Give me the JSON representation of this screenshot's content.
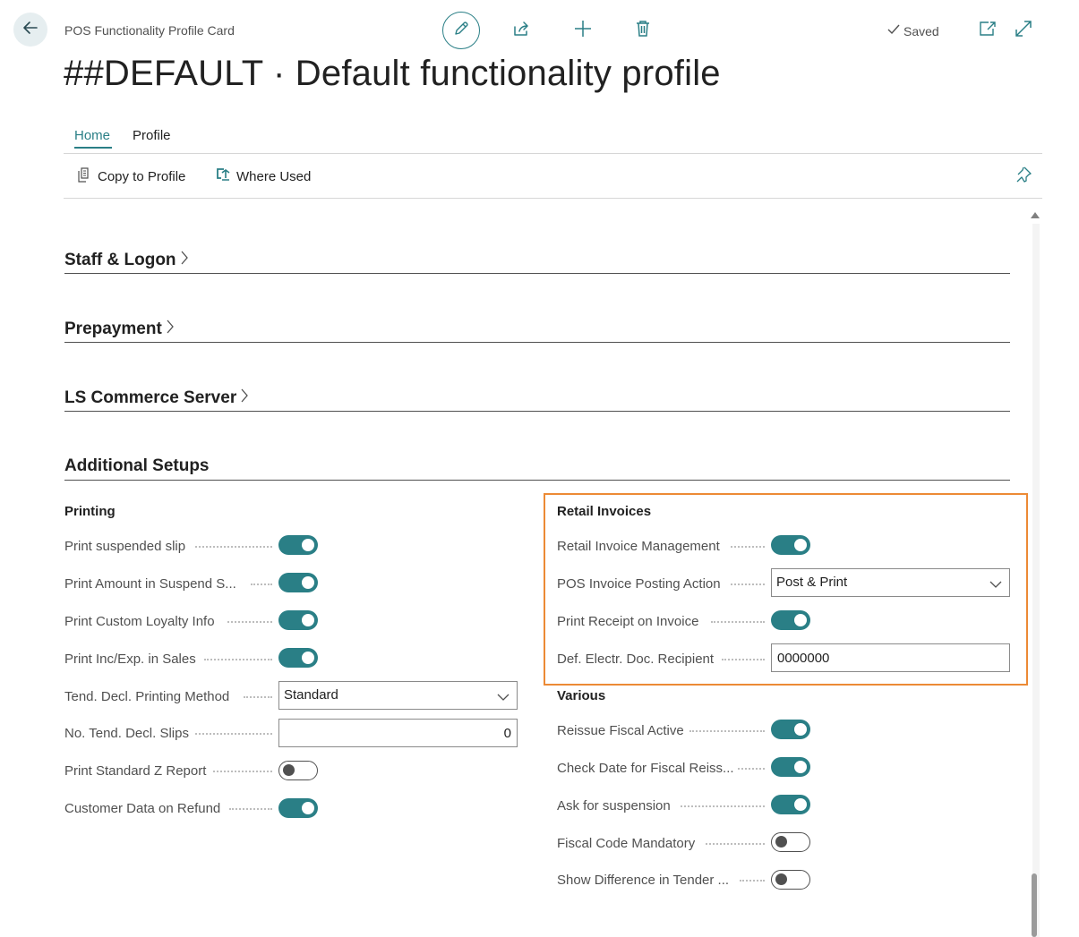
{
  "header": {
    "page_type": "POS Functionality Profile Card",
    "title": "##DEFAULT · Default functionality profile",
    "saved_label": "Saved"
  },
  "tabs": [
    "Home",
    "Profile"
  ],
  "actions": {
    "copy_to_profile": "Copy to Profile",
    "where_used": "Where Used"
  },
  "fasttabs": {
    "staff_logon": "Staff & Logon",
    "prepayment": "Prepayment",
    "ls_commerce_server": "LS Commerce Server",
    "additional_setups": "Additional Setups"
  },
  "printing": {
    "heading": "Printing",
    "print_suspended_slip": {
      "label": "Print suspended slip",
      "value": true
    },
    "print_amount_in_suspend": {
      "label": "Print Amount in Suspend S...",
      "value": true
    },
    "print_custom_loyalty_info": {
      "label": "Print Custom Loyalty Info",
      "value": true
    },
    "print_inc_exp_in_sales": {
      "label": "Print Inc/Exp. in Sales",
      "value": true
    },
    "tend_decl_printing_method": {
      "label": "Tend. Decl. Printing Method",
      "value": "Standard"
    },
    "no_tend_decl_slips": {
      "label": "No. Tend. Decl. Slips",
      "value": "0"
    },
    "print_standard_z_report": {
      "label": "Print Standard Z Report",
      "value": false
    },
    "customer_data_on_refund": {
      "label": "Customer Data on Refund",
      "value": true
    }
  },
  "retail_invoices": {
    "heading": "Retail Invoices",
    "retail_invoice_management": {
      "label": "Retail Invoice Management",
      "value": true
    },
    "pos_invoice_posting_action": {
      "label": "POS Invoice Posting Action",
      "value": "Post & Print"
    },
    "print_receipt_on_invoice": {
      "label": "Print Receipt on Invoice",
      "value": true
    },
    "def_electr_doc_recipient": {
      "label": "Def. Electr. Doc. Recipient",
      "value": "0000000"
    }
  },
  "various": {
    "heading": "Various",
    "reissue_fiscal_active": {
      "label": "Reissue Fiscal Active",
      "value": true
    },
    "check_date_for_fiscal_reissue": {
      "label": "Check Date for Fiscal Reiss...",
      "value": true
    },
    "ask_for_suspension": {
      "label": "Ask for suspension",
      "value": true
    },
    "fiscal_code_mandatory": {
      "label": "Fiscal Code Mandatory",
      "value": false
    },
    "show_difference_in_tender": {
      "label": "Show Difference in Tender ...",
      "value": false
    }
  },
  "colors": {
    "accent": "#2a7f86",
    "highlight_box": "#ec8a35",
    "toggle_off_knob": "#505050"
  },
  "icons": {
    "back": "arrow-left-icon",
    "edit": "pencil-icon",
    "share": "share-icon",
    "new": "plus-icon",
    "delete": "trash-icon",
    "saved": "checkmark-icon",
    "open_new_window": "open-in-new-window-icon",
    "expand": "expand-icon",
    "copy": "copy-icon",
    "where_used": "where-used-icon",
    "pin": "pin-icon",
    "chevron_right": "chevron-right-icon",
    "chevron_down": "chevron-down-icon"
  }
}
